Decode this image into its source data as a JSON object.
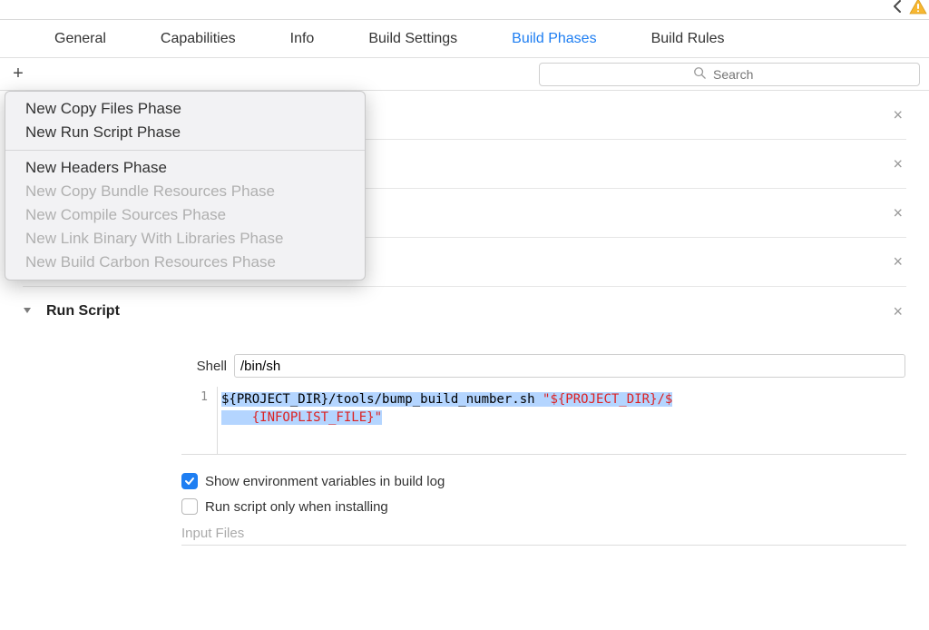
{
  "toolbar": {
    "warning_count": ""
  },
  "tabs": {
    "general": "General",
    "capabilities": "Capabilities",
    "info": "Info",
    "build_settings": "Build Settings",
    "build_phases": "Build Phases",
    "build_rules": "Build Rules",
    "active": "build_phases"
  },
  "subbar": {
    "search_placeholder": "Search"
  },
  "menu": {
    "items": [
      {
        "label": "New Copy Files Phase",
        "enabled": true
      },
      {
        "label": "New Run Script Phase",
        "enabled": true
      }
    ],
    "items2": [
      {
        "label": "New Headers Phase",
        "enabled": true
      },
      {
        "label": "New Copy Bundle Resources Phase",
        "enabled": false
      },
      {
        "label": "New Compile Sources Phase",
        "enabled": false
      },
      {
        "label": "New Link Binary With Libraries Phase",
        "enabled": false
      },
      {
        "label": "New Build Carbon Resources Phase",
        "enabled": false
      }
    ]
  },
  "phases": {
    "run_script_collapsed": "Run Script",
    "run_script_open": "Run Script"
  },
  "script": {
    "shell_label": "Shell",
    "shell_value": "/bin/sh",
    "gutter_1": "1",
    "code_plain": "${PROJECT_DIR}/tools/bump_build_number.sh ",
    "code_red1": "\"${PROJECT_DIR}/$",
    "code_red_indent": "    {INFOPLIST_FILE}\""
  },
  "options": {
    "show_env": "Show environment variables in build log",
    "show_env_checked": true,
    "only_installing": "Run script only when installing",
    "only_installing_checked": false,
    "input_files": "Input Files"
  }
}
